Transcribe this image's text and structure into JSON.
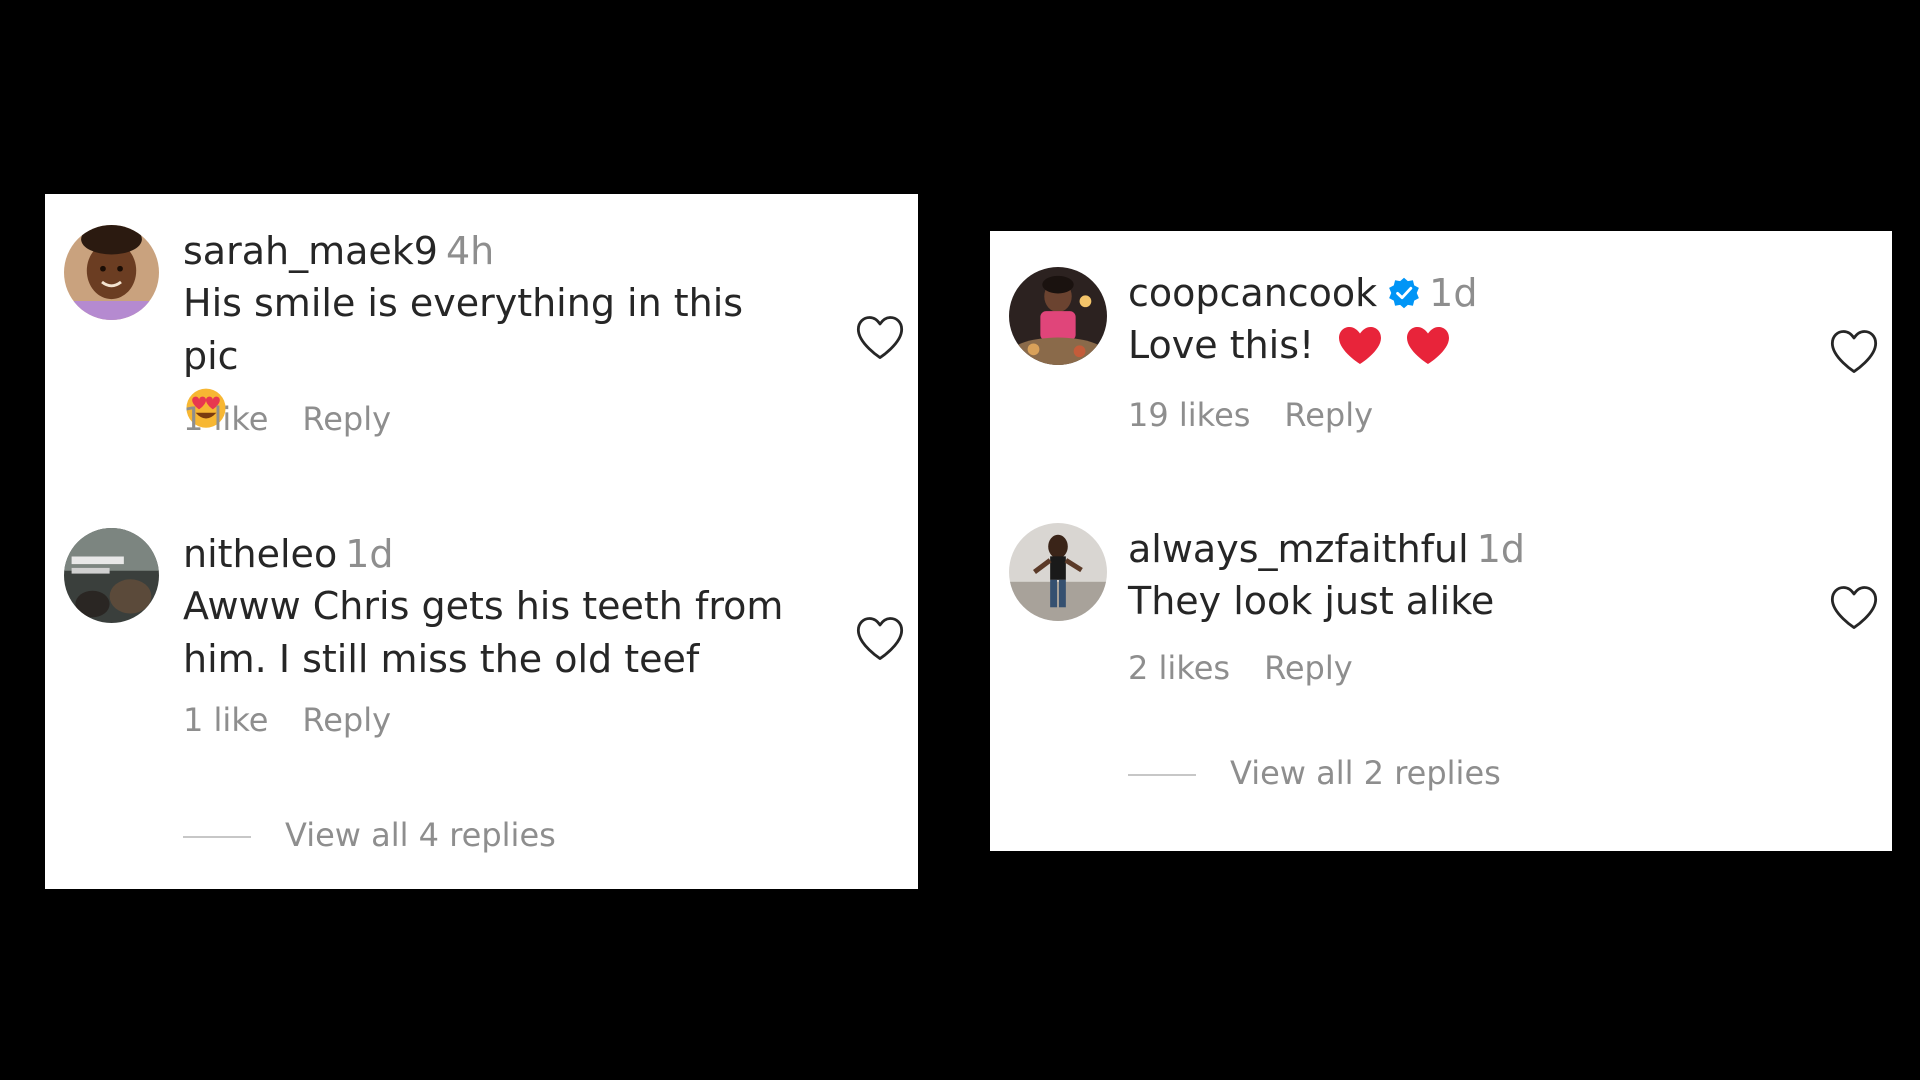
{
  "left_panel": {
    "comments": [
      {
        "username": "sarah_maek9",
        "time": "4h",
        "text": "His smile is everything in this pic",
        "emoji_icon": "heart-eyes-emoji",
        "likes": "1 like",
        "reply": "Reply"
      },
      {
        "username": "nitheleo",
        "time": "1d",
        "text_line1": "Awww Chris gets his teeth from",
        "text_line2": "him. I still miss the old teef",
        "likes": "1 like",
        "reply": "Reply"
      }
    ],
    "view_replies": "View all 4 replies"
  },
  "right_panel": {
    "comments": [
      {
        "username": "coopcancook",
        "verified_icon": "verified-badge-icon",
        "time": "1d",
        "text": "Love this!",
        "emoji_icon": "red-heart-emoji",
        "likes": "19 likes",
        "reply": "Reply"
      },
      {
        "username": "always_mzfaithful",
        "time": "1d",
        "text": "They look just alike",
        "likes": "2 likes",
        "reply": "Reply"
      }
    ],
    "view_replies": "View all 2 replies"
  },
  "colors": {
    "background": "#000000",
    "panel": "#ffffff",
    "primary_text": "#262626",
    "secondary_text": "#8e8e8e",
    "verified_blue": "#0095f6",
    "heart_red": "#ed4956"
  }
}
